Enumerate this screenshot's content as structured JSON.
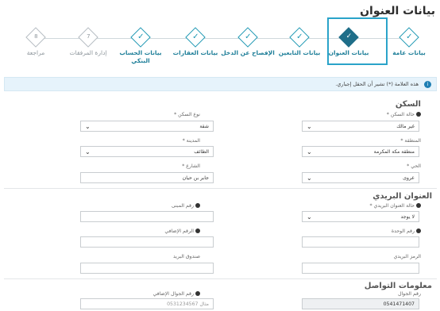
{
  "page": {
    "title": "بيانات العنوان"
  },
  "stepper": {
    "steps": [
      {
        "label": "بيانات عامة",
        "state": "done",
        "mark": "✓"
      },
      {
        "label": "بيانات العنوان",
        "state": "active",
        "mark": "✓"
      },
      {
        "label": "بيانات التابعين",
        "state": "done",
        "mark": "✓"
      },
      {
        "label": "الإفصاح عن الدخل",
        "state": "done",
        "mark": "✓"
      },
      {
        "label": "بيانات العقارات",
        "state": "done",
        "mark": "✓"
      },
      {
        "label": "بيانات الحساب البنكي",
        "state": "done",
        "mark": "✓"
      },
      {
        "label": "إدارة المرفقات",
        "state": "pending",
        "mark": "7"
      },
      {
        "label": "مراجعة",
        "state": "pending",
        "mark": "8"
      }
    ]
  },
  "notice": {
    "text": "هذه العلامة (*) تشير أن الحقل إجباري."
  },
  "housing": {
    "title": "السكن",
    "fields": {
      "housing_status": {
        "label": "حالة السكن *",
        "value": "غير مالك"
      },
      "housing_type": {
        "label": "نوع السكن *",
        "value": "شقة"
      },
      "region": {
        "label": "المنطقة *",
        "value": "منطقة مكة المكرمة"
      },
      "city": {
        "label": "المدينة *",
        "value": "الطائف"
      },
      "district": {
        "label": "الحي *",
        "value": "عروى"
      },
      "street": {
        "label": "الشارع *",
        "value": "جابر بن حيان"
      }
    }
  },
  "postal": {
    "title": "العنوان البريدي",
    "fields": {
      "has_postal": {
        "label": "حالة العنوان البريدي *",
        "value": "لا يوجد"
      },
      "building_no": {
        "label": "رقم المبنى",
        "value": ""
      },
      "unit_no": {
        "label": "رقم الوحدة",
        "value": ""
      },
      "additional_no": {
        "label": "الرقم الإضافي",
        "value": ""
      },
      "postal_code": {
        "label": "الرمز البريدي",
        "value": ""
      },
      "po_box": {
        "label": "صندوق البريد",
        "value": ""
      }
    }
  },
  "contact": {
    "title": "معلومات التواصل",
    "fields": {
      "mobile": {
        "label": "رقم الجوال",
        "value": "0541471407"
      },
      "alt_mobile": {
        "label": "رقم الجوال الإضافي",
        "placeholder": "مثال 0531234567"
      }
    }
  }
}
